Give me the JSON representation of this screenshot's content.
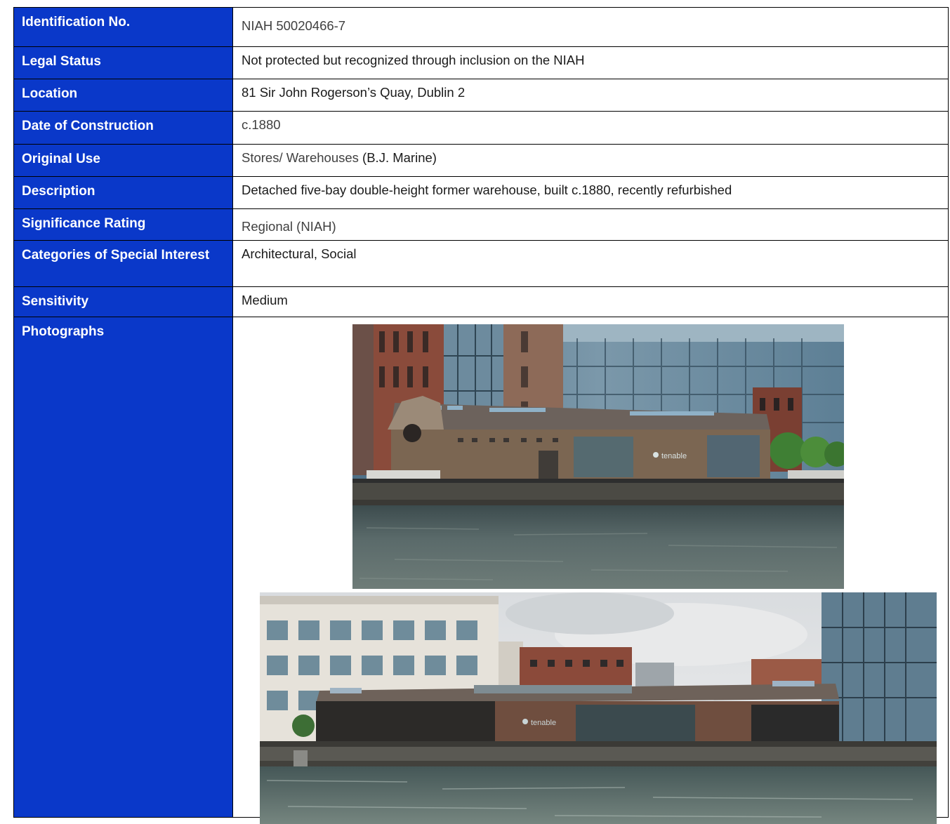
{
  "record": {
    "id_label": "Identification No.",
    "id_value": "NIAH 50020466-7",
    "status_label": "Legal Status",
    "status_value": "Not protected but recognized through inclusion on the NIAH",
    "location_label": "Location",
    "location_value": "81 Sir John Rogerson’s Quay, Dublin 2",
    "date_label": "Date of Construction",
    "date_value": "c.1880",
    "use_label": "Original Use",
    "use_value_a": "Stores/ Warehouses",
    "use_value_b": " (B.J. Marine)",
    "desc_label": "Description",
    "desc_value": "Detached five-bay double-height former warehouse, built c.1880, recently refurbished",
    "sig_label": "Significance Rating",
    "sig_value": "Regional (NIAH)",
    "cat_label": "Categories of Special Interest",
    "cat_value": "Architectural, Social",
    "sens_label": "Sensitivity",
    "sens_value": "Medium",
    "photos_label": "Photographs"
  },
  "photos": {
    "photo1_sign": "tenable",
    "photo2_sign": "tenable"
  },
  "colors": {
    "label_bg": "#0a38c9",
    "label_text": "#ffffff",
    "border": "#000000"
  }
}
